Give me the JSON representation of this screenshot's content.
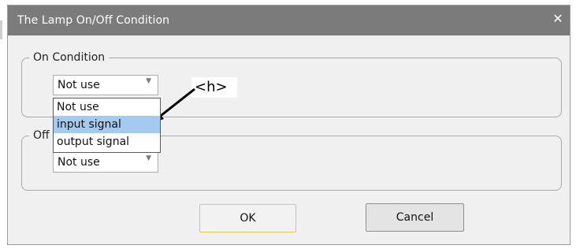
{
  "dialog": {
    "title": "The Lamp On/Off Condition",
    "close_glyph": "✕"
  },
  "on_group": {
    "legend": "On Condition",
    "select_value": "Not use"
  },
  "off_group": {
    "legend": "Off",
    "select_value": "Not use"
  },
  "dropdown": {
    "items": [
      "Not use",
      "input signal",
      "output signal"
    ],
    "highlighted_index": 1
  },
  "annotation": {
    "label": "<h>"
  },
  "buttons": {
    "ok_label": "OK",
    "cancel_label": "Cancel"
  },
  "colors": {
    "titlebar": "#7b7b7b",
    "dialog_bg": "#f0f0f0",
    "selection": "#a4cbef",
    "ok_border": "#e7c55a"
  },
  "icons": {
    "close": "close-icon",
    "dropdown_arrow": "chevron-down-icon"
  }
}
